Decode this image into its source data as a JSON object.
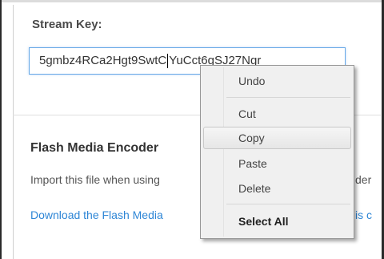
{
  "stream": {
    "label": "Stream Key:",
    "key_before_caret": "5gmbz4RCa2Hgt9SwtC",
    "key_after_caret": "YuCct6gSJ27Ngr"
  },
  "fme": {
    "title": "Flash Media Encoder",
    "description": "Import this file when using",
    "description_tail": "der",
    "link": "Download the Flash Media",
    "link_tail": "is c"
  },
  "context_menu": {
    "items": [
      {
        "label": "Undo"
      },
      {
        "label": "Cut"
      },
      {
        "label": "Copy",
        "highlighted": true
      },
      {
        "label": "Paste"
      },
      {
        "label": "Delete"
      },
      {
        "label": "Select All"
      }
    ]
  }
}
